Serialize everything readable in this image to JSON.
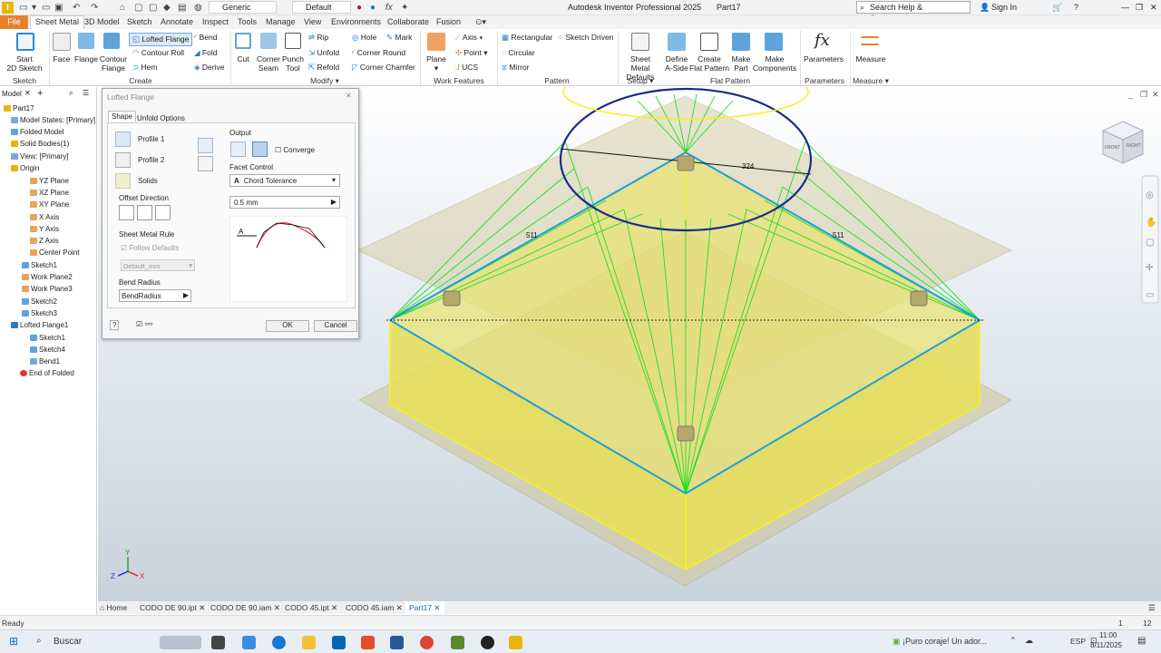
{
  "app": {
    "title": "Autodesk Inventor Professional 2025",
    "doc": "Part17",
    "search_placeholder": "Search Help & Commands...",
    "sign_in": "Sign In"
  },
  "qat": {
    "material": "Generic",
    "appearance": "Default"
  },
  "tabs": [
    "File",
    "Sheet Metal",
    "3D Model",
    "Sketch",
    "Annotate",
    "Inspect",
    "Tools",
    "Manage",
    "View",
    "Environments",
    "Collaborate",
    "Fusion"
  ],
  "ribbon": {
    "start_sketch": "Start\n2D Sketch",
    "face": "Face",
    "flange": "Flange",
    "contour_flange": "Contour\nFlange",
    "lofted_flange": "Lofted Flange",
    "contour_roll": "Contour Roll",
    "hem": "Hem",
    "bend": "Bend",
    "fold": "Fold",
    "derive": "Derive",
    "cut": "Cut",
    "corner_seam": "Corner\nSeam",
    "punch_tool": "Punch\nTool",
    "rip": "Rip",
    "unfold": "Unfold",
    "refold": "Refold",
    "hole": "Hole",
    "mark": "Mark",
    "corner_round": "Corner Round",
    "corner_chamfer": "Corner Chamfer",
    "plane": "Plane",
    "axis": "Axis",
    "point": "Point",
    "ucs": "UCS",
    "rectangular": "Rectangular",
    "sketch_driven": "Sketch Driven",
    "circular": "Circular",
    "mirror": "Mirror",
    "sm_defaults": "Sheet Metal\nDefaults",
    "define_aside": "Define\nA-Side",
    "create_flat": "Create\nFlat Pattern",
    "make_part": "Make\nPart",
    "make_components": "Make\nComponents",
    "parameters": "Parameters",
    "measure": "Measure",
    "groups": {
      "sketch": "Sketch",
      "create": "Create",
      "modify": "Modify",
      "work_features": "Work Features",
      "pattern": "Pattern",
      "setup": "Setup",
      "flat_pattern": "Flat Pattern",
      "parameters": "Parameters",
      "measure": "Measure"
    }
  },
  "browser": {
    "tab": "Model",
    "items": [
      "Part17",
      "Model States: [Primary]",
      "Folded Model",
      "Solid Bodies(1)",
      "View: [Primary]",
      "Origin",
      "YZ Plane",
      "XZ Plane",
      "XY Plane",
      "X Axis",
      "Y Axis",
      "Z Axis",
      "Center Point",
      "Sketch1",
      "Work Plane2",
      "Work Plane3",
      "Sketch2",
      "Sketch3",
      "Lofted Flange1",
      "Sketch1",
      "Sketch4",
      "Bend1",
      "End of Folded"
    ]
  },
  "dialog": {
    "title": "Lofted Flange",
    "tab_shape": "Shape",
    "tab_unfold": "Unfold Options",
    "profile1": "Profile 1",
    "profile2": "Profile 2",
    "solids": "Solids",
    "offset_direction": "Offset Direction",
    "sheet_metal_rule": "Sheet Metal Rule",
    "follow_defaults": "Follow Defaults",
    "rule_value": "Default_mm",
    "bend_radius_label": "Bend Radius",
    "bend_radius": "BendRadius",
    "output": "Output",
    "converge": "Converge",
    "facet_control": "Facet Control",
    "facet_value": "Chord Tolerance",
    "tolerance": "0.5 mm",
    "ok": "OK",
    "cancel": "Cancel"
  },
  "viewport": {
    "dim_top": "324",
    "dim_left": "511",
    "dim_right": "511",
    "viewcube_front": "FRONT",
    "viewcube_right": "RIGHT",
    "axis_x": "X",
    "axis_y": "Y",
    "axis_z": "Z"
  },
  "doctabs": [
    "Home",
    "CODO DE 90.ipt",
    "CODO DE 90.iam",
    "CODO 45.ipt",
    "CODO 45.iam",
    "Part17"
  ],
  "status": {
    "left": "Ready",
    "count1": "1",
    "count2": "12"
  },
  "taskbar": {
    "search": "Buscar",
    "notification": "¡Puro coraje! Un ador...",
    "lang": "ESP",
    "time": "11:00",
    "date": "8/11/2025"
  },
  "colors": {
    "file_tab": "#e8812c",
    "accent": "#0f6cbd",
    "loft_lines": "#22dd22",
    "yellow_body": "#e9e46e",
    "blue_edges": "#1f9fd9",
    "circle": "#1b2a8a"
  }
}
